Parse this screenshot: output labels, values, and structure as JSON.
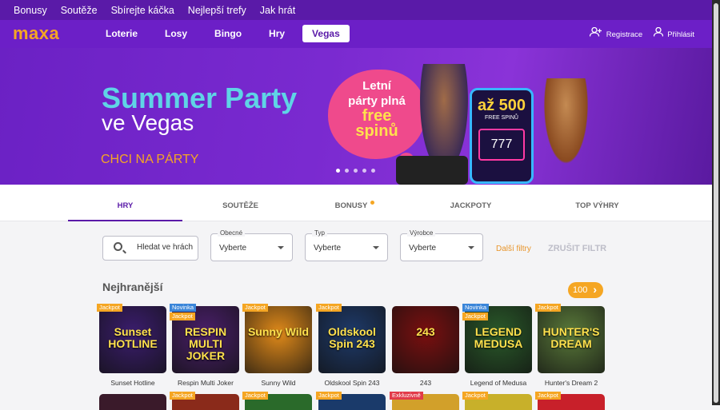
{
  "topbar": {
    "links": [
      "Bonusy",
      "Soutěže",
      "Sbírejte káčka",
      "Nejlepší trefy",
      "Jak hrát"
    ]
  },
  "nav": {
    "logo": "maxa",
    "items": [
      {
        "label": "Loterie",
        "active": false
      },
      {
        "label": "Losy",
        "active": false
      },
      {
        "label": "Bingo",
        "active": false
      },
      {
        "label": "Hry",
        "active": false
      },
      {
        "label": "Vegas",
        "active": true
      }
    ],
    "register": "Registrace",
    "login": "Přihlásit",
    "register_icon": "add-user-icon",
    "login_icon": "user-icon"
  },
  "hero": {
    "title": "Summer Party",
    "subtitle": "ve Vegas",
    "cta": "CHCI NA PÁRTY",
    "bubble_line1": "Letní",
    "bubble_line2": "párty plná",
    "bubble_line3": "free",
    "bubble_line4": "spinů",
    "slot_amount": "až 500",
    "slot_caption": "FREE SPINŮ",
    "slot_reels": "777",
    "slides": 5,
    "active_slide": 1
  },
  "tabs": [
    {
      "label": "HRY",
      "active": true
    },
    {
      "label": "SOUTĚŽE",
      "active": false
    },
    {
      "label": "BONUSY",
      "active": false,
      "dot": true
    },
    {
      "label": "JACKPOTY",
      "active": false
    },
    {
      "label": "TOP VÝHRY",
      "active": false
    }
  ],
  "filters": {
    "search_placeholder": "Hledat ve hrách",
    "selects": [
      {
        "label": "Obecné",
        "value": "Vyberte"
      },
      {
        "label": "Typ",
        "value": "Vyberte"
      },
      {
        "label": "Výrobce",
        "value": "Vyberte"
      }
    ],
    "more": "Další filtry",
    "clear": "ZRUŠIT FILTR"
  },
  "section": {
    "title": "Nejhranější",
    "count": "100"
  },
  "games": [
    {
      "name": "Sunset Hotline",
      "art": "Sunset HOTLINE",
      "badges": [
        "Jackpot"
      ],
      "bg": "#3b1d6e"
    },
    {
      "name": "Respin Multi Joker",
      "art": "RESPIN MULTI JOKER",
      "badges": [
        "Novinka",
        "Jackpot"
      ],
      "bg": "#4a1f6a"
    },
    {
      "name": "Sunny Wild",
      "art": "Sunny Wild",
      "badges": [
        "Jackpot"
      ],
      "bg": "#e08a1a"
    },
    {
      "name": "Oldskool Spin 243",
      "art": "Oldskool Spin 243",
      "badges": [
        "Jackpot"
      ],
      "bg": "#1e3a6a"
    },
    {
      "name": "243",
      "art": "243",
      "badges": [],
      "bg": "#7a0f0f"
    },
    {
      "name": "Legend of Medusa",
      "art": "LEGEND MEDUSA",
      "badges": [
        "Novinka",
        "Jackpot"
      ],
      "bg": "#2a5a2a"
    },
    {
      "name": "Hunter's Dream 2",
      "art": "HUNTER'S DREAM",
      "badges": [
        "Jackpot"
      ],
      "bg": "#5a7a3a"
    }
  ],
  "games_row2": [
    {
      "badges": [],
      "bg": "#3a1a2a"
    },
    {
      "badges": [
        "Jackpot"
      ],
      "bg": "#8a2a1a"
    },
    {
      "badges": [
        "Jackpot"
      ],
      "bg": "#2a6a2a"
    },
    {
      "badges": [
        "Jackpot"
      ],
      "bg": "#1a3a6a"
    },
    {
      "badges": [
        "Exkluzivně"
      ],
      "bg": "#d2a02a"
    },
    {
      "badges": [
        "Jackpot"
      ],
      "bg": "#c8b02a"
    },
    {
      "badges": [
        "Jackpot"
      ],
      "bg": "#c8202a"
    }
  ]
}
